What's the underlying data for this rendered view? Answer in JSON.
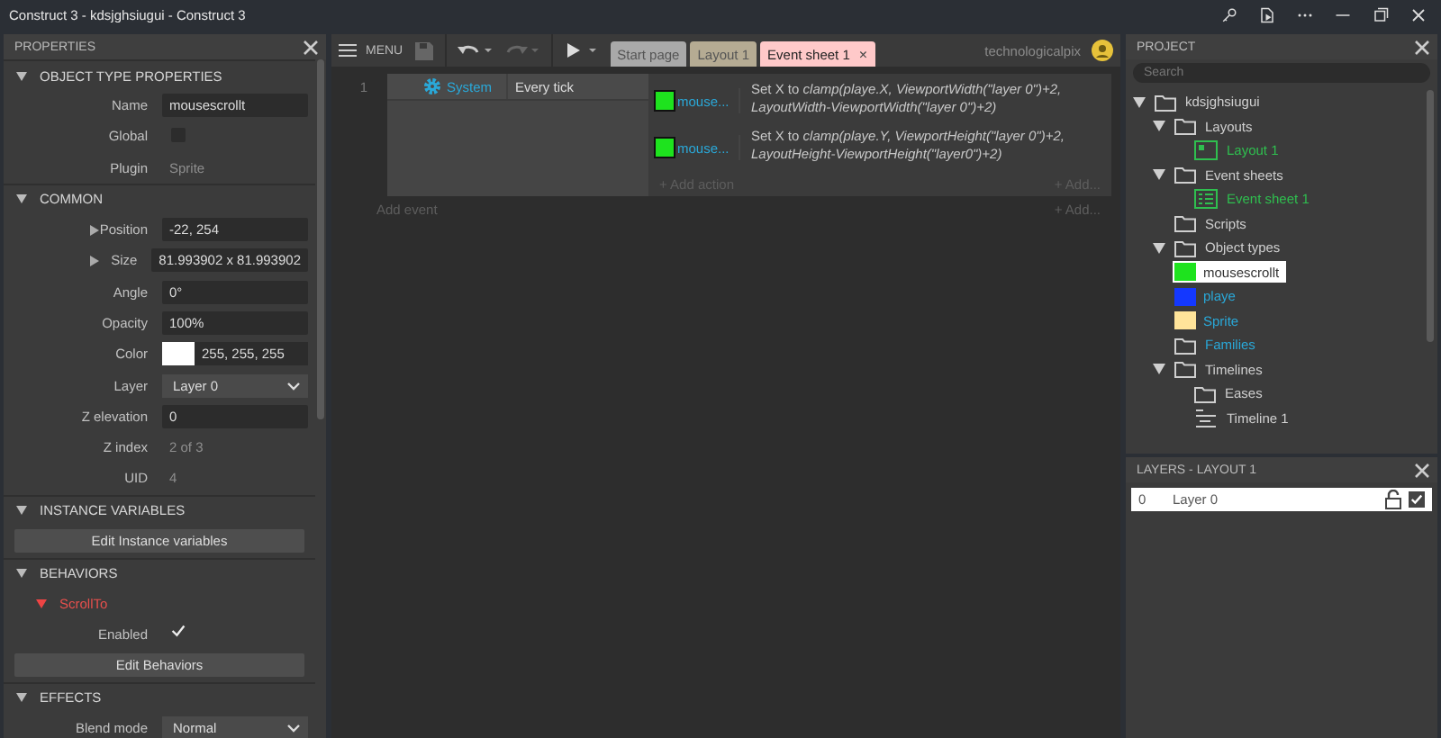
{
  "window": {
    "title": "Construct 3 - kdsjghsiugui - Construct 3"
  },
  "properties": {
    "title": "PROPERTIES",
    "sections": [
      {
        "title": "OBJECT TYPE PROPERTIES",
        "expanded": true,
        "rows": [
          {
            "kind": "field",
            "label": "Name",
            "value": "mousescrollt"
          },
          {
            "kind": "checkbox",
            "label": "Global",
            "checked": false
          },
          {
            "kind": "text",
            "label": "Plugin",
            "value": "Sprite"
          }
        ]
      },
      {
        "title": "COMMON",
        "expanded": true,
        "rows": [
          {
            "kind": "field",
            "label": "Position",
            "value": "-22, 254",
            "expanded": false
          },
          {
            "kind": "field",
            "label": "Size",
            "value": "81.993902 x 81.993902",
            "expanded": false
          },
          {
            "kind": "field",
            "label": "Angle",
            "value": "0°"
          },
          {
            "kind": "field",
            "label": "Opacity",
            "value": "100%"
          },
          {
            "kind": "color",
            "label": "Color",
            "value": "255, 255, 255",
            "color": "#ffffff"
          },
          {
            "kind": "select",
            "label": "Layer",
            "value": "Layer 0"
          },
          {
            "kind": "field",
            "label": "Z elevation",
            "value": "0"
          },
          {
            "kind": "text",
            "label": "Z index",
            "value": "2 of 3"
          },
          {
            "kind": "text",
            "label": "UID",
            "value": "4"
          }
        ]
      },
      {
        "title": "INSTANCE VARIABLES",
        "expanded": true,
        "rows": [
          {
            "kind": "button",
            "label": "Edit Instance variables"
          }
        ]
      },
      {
        "title": "BEHAVIORS",
        "expanded": true,
        "rows": [
          {
            "kind": "behavior",
            "label": "ScrollTo",
            "expanded": true
          },
          {
            "kind": "checkbox",
            "label": "Enabled",
            "checked": true
          },
          {
            "kind": "button",
            "label": "Edit Behaviors"
          }
        ]
      },
      {
        "title": "EFFECTS",
        "expanded": true,
        "rows": [
          {
            "kind": "select",
            "label": "Blend mode",
            "value": "Normal"
          }
        ]
      }
    ]
  },
  "toolbar": {
    "menu": "MENU",
    "tabs": [
      {
        "label": "Start page",
        "selected": false,
        "color": "#a9a9a9"
      },
      {
        "label": "Layout 1",
        "selected": false,
        "color": "#b5ab93"
      },
      {
        "label": "Event sheet 1",
        "selected": true,
        "color": "#ffc9c9",
        "close": "×"
      }
    ],
    "user": "technologicalpix"
  },
  "event_sheet": {
    "events": [
      {
        "number": "1",
        "conditions": [
          {
            "object": "System",
            "text": "Every tick"
          }
        ],
        "actions": [
          {
            "object": "mouse...",
            "color": "#1ee31e",
            "text": "Set X to *clamp(playe.X, ViewportWidth(\"layer 0\")+2, LayoutWidth-ViewportWidth(\"layer 0\")+2)*"
          },
          {
            "object": "mouse...",
            "color": "#1ee31e",
            "text": "Set X to *clamp(playe.Y, ViewportHeight(\"layer 0\")+2, LayoutHeight-ViewportHeight(\"layer0\")+2)*"
          }
        ],
        "add_action": "+ Add action",
        "add_condition": "+ Add..."
      }
    ],
    "add_event": "Add event",
    "add_more": "+ Add..."
  },
  "project": {
    "title": "PROJECT",
    "search": {
      "placeholder": "Search"
    },
    "tree": [
      {
        "kind": "folder",
        "label": "kdsjghsiugui",
        "expanded": true,
        "children": [
          {
            "kind": "folder",
            "label": "Layouts",
            "expanded": true,
            "children": [
              {
                "kind": "layout",
                "label": "Layout 1"
              }
            ]
          },
          {
            "kind": "folder",
            "label": "Event sheets",
            "expanded": true,
            "children": [
              {
                "kind": "eventsheet",
                "label": "Event sheet 1"
              }
            ]
          },
          {
            "kind": "folder",
            "label": "Scripts"
          },
          {
            "kind": "folder",
            "label": "Object types",
            "expanded": true,
            "children": [
              {
                "kind": "object",
                "label": "mousescrollt",
                "color": "#1ee31e",
                "selected": true
              },
              {
                "kind": "object",
                "label": "playe",
                "color": "#1438ff",
                "selected": false
              },
              {
                "kind": "object",
                "label": "Sprite",
                "color": "#ffe49a",
                "selected": false
              }
            ]
          },
          {
            "kind": "family",
            "label": "Families"
          },
          {
            "kind": "folder",
            "label": "Timelines",
            "expanded": true,
            "children": [
              {
                "kind": "folder",
                "label": "Eases"
              },
              {
                "kind": "timeline",
                "label": "Timeline 1"
              }
            ]
          }
        ]
      }
    ]
  },
  "layers": {
    "title": "LAYERS - LAYOUT 1",
    "items": [
      {
        "index": "0",
        "name": "Layer 0",
        "visible": true
      }
    ]
  }
}
